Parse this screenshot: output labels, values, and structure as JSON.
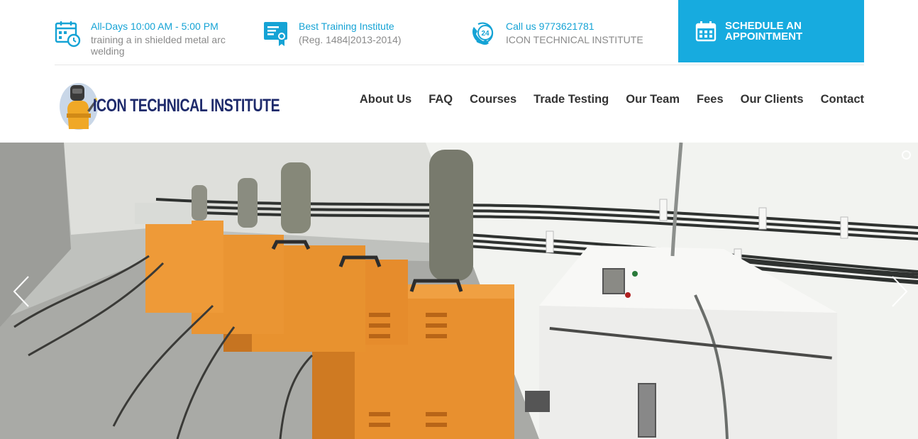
{
  "topbar": {
    "hours": {
      "icon": "calendar-clock-icon",
      "title": "All-Days 10:00 AM - 5:00 PM",
      "subtitle": "training a in shielded metal arc welding"
    },
    "training": {
      "icon": "certificate-icon",
      "title": "Best Training Institute",
      "subtitle": "(Reg. 1484|2013-2014)"
    },
    "call": {
      "icon": "phone-24-icon",
      "title": "Call us 9773621781",
      "subtitle": "ICON TECHNICAL INSTITUTE"
    },
    "cta": {
      "icon": "calendar-icon",
      "label": "SCHEDULE AN APPOINTMENT"
    }
  },
  "brand": {
    "logo_text": "ICON TECHNICAL INSTITUTE"
  },
  "nav": {
    "items": [
      "About Us",
      "FAQ",
      "Courses",
      "Trade Testing",
      "Our Team",
      "Fees",
      "Our Clients",
      "Contact"
    ]
  },
  "hero": {
    "image": "welding-workshop-photo",
    "prev_icon": "chevron-left-icon",
    "next_icon": "chevron-right-icon",
    "slides_indicator": "slide-dot"
  },
  "colors": {
    "accent": "#17abdf",
    "accent_text": "#15a3d5",
    "nav_text": "#333333",
    "muted_text": "#8a8a8a",
    "logo_text": "#1e2a6b",
    "machine_orange": "#e8902f"
  }
}
